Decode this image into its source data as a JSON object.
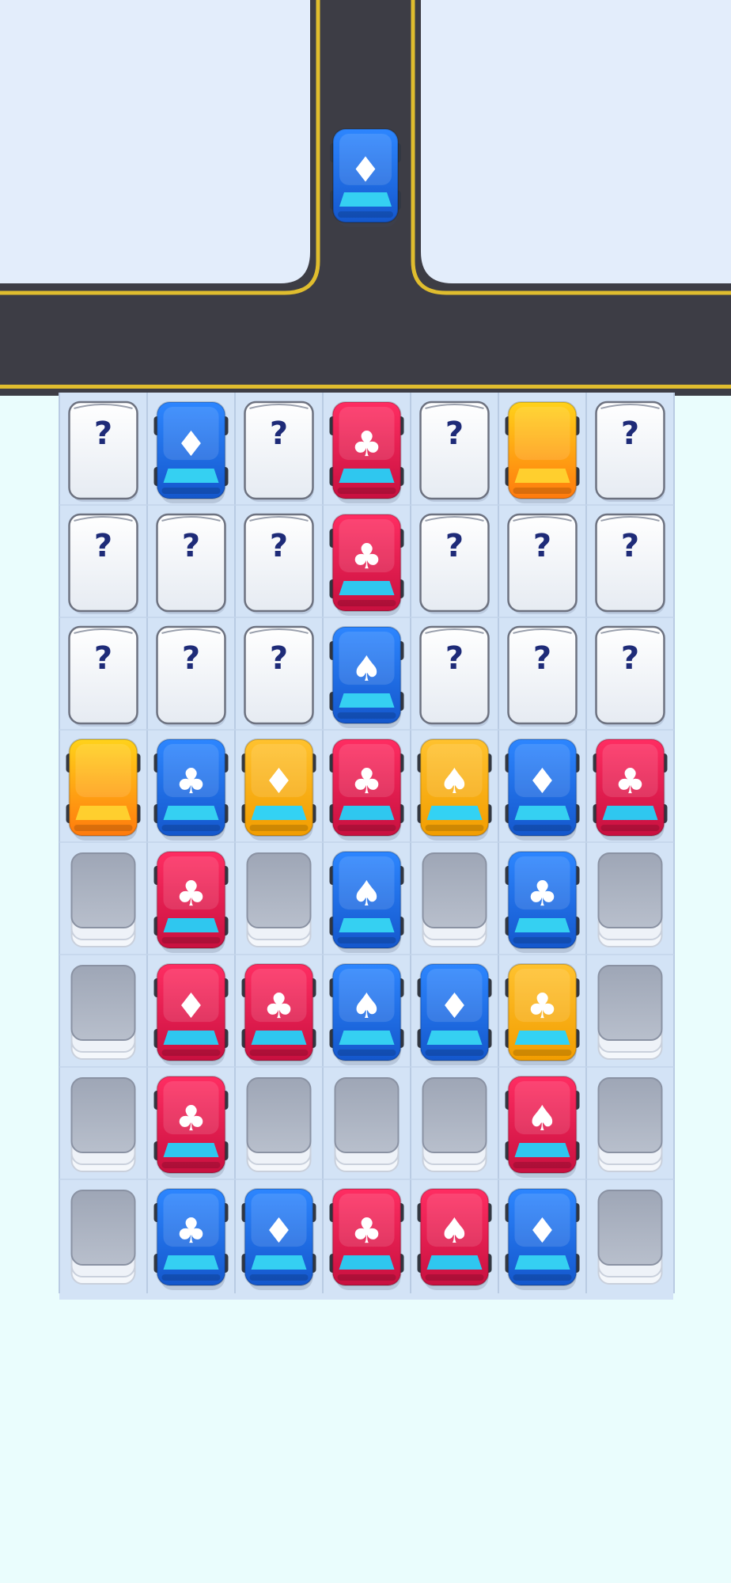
{
  "colors": {
    "sky": "#e3edfb",
    "road": "#3d3d45",
    "road_line": "#e0bd2e",
    "lot": "#d3e3f6",
    "background": "#eafdfd",
    "blue": "#1f6de6",
    "red": "#e21a50",
    "yellow": "#ffb21a",
    "orange": "#ff9c0d",
    "empty_stack": "#aeb5c4"
  },
  "road_car": {
    "color": "blue",
    "suit": "diamond",
    "label": "♦"
  },
  "suit_glyphs": {
    "diamond": "♦",
    "club": "♣",
    "spade": "♠"
  },
  "mystery_label": "?",
  "grid": {
    "rows": [
      [
        {
          "type": "mystery"
        },
        {
          "type": "car",
          "color": "blue",
          "suit": "diamond"
        },
        {
          "type": "mystery"
        },
        {
          "type": "car",
          "color": "red",
          "suit": "club"
        },
        {
          "type": "mystery"
        },
        {
          "type": "car",
          "color": "orange",
          "suit": "none"
        },
        {
          "type": "mystery"
        }
      ],
      [
        {
          "type": "mystery"
        },
        {
          "type": "mystery"
        },
        {
          "type": "mystery"
        },
        {
          "type": "car",
          "color": "red",
          "suit": "club"
        },
        {
          "type": "mystery"
        },
        {
          "type": "mystery"
        },
        {
          "type": "mystery"
        }
      ],
      [
        {
          "type": "mystery"
        },
        {
          "type": "mystery"
        },
        {
          "type": "mystery"
        },
        {
          "type": "car",
          "color": "blue",
          "suit": "spade"
        },
        {
          "type": "mystery"
        },
        {
          "type": "mystery"
        },
        {
          "type": "mystery"
        }
      ],
      [
        {
          "type": "car",
          "color": "orange",
          "suit": "none"
        },
        {
          "type": "car",
          "color": "blue",
          "suit": "club"
        },
        {
          "type": "car",
          "color": "yellow",
          "suit": "diamond"
        },
        {
          "type": "car",
          "color": "red",
          "suit": "club"
        },
        {
          "type": "car",
          "color": "yellow",
          "suit": "spade"
        },
        {
          "type": "car",
          "color": "blue",
          "suit": "diamond"
        },
        {
          "type": "car",
          "color": "red",
          "suit": "club"
        }
      ],
      [
        {
          "type": "empty"
        },
        {
          "type": "car",
          "color": "red",
          "suit": "club"
        },
        {
          "type": "empty"
        },
        {
          "type": "car",
          "color": "blue",
          "suit": "spade"
        },
        {
          "type": "empty"
        },
        {
          "type": "car",
          "color": "blue",
          "suit": "club"
        },
        {
          "type": "empty"
        }
      ],
      [
        {
          "type": "empty"
        },
        {
          "type": "car",
          "color": "red",
          "suit": "diamond"
        },
        {
          "type": "car",
          "color": "red",
          "suit": "club"
        },
        {
          "type": "car",
          "color": "blue",
          "suit": "spade"
        },
        {
          "type": "car",
          "color": "blue",
          "suit": "diamond"
        },
        {
          "type": "car",
          "color": "yellow",
          "suit": "club"
        },
        {
          "type": "empty"
        }
      ],
      [
        {
          "type": "empty"
        },
        {
          "type": "car",
          "color": "red",
          "suit": "club"
        },
        {
          "type": "empty"
        },
        {
          "type": "empty"
        },
        {
          "type": "empty"
        },
        {
          "type": "car",
          "color": "red",
          "suit": "spade"
        },
        {
          "type": "empty"
        }
      ],
      [
        {
          "type": "empty"
        },
        {
          "type": "car",
          "color": "blue",
          "suit": "club"
        },
        {
          "type": "car",
          "color": "blue",
          "suit": "diamond"
        },
        {
          "type": "car",
          "color": "red",
          "suit": "club"
        },
        {
          "type": "car",
          "color": "red",
          "suit": "spade"
        },
        {
          "type": "car",
          "color": "blue",
          "suit": "diamond"
        },
        {
          "type": "empty"
        }
      ]
    ]
  }
}
